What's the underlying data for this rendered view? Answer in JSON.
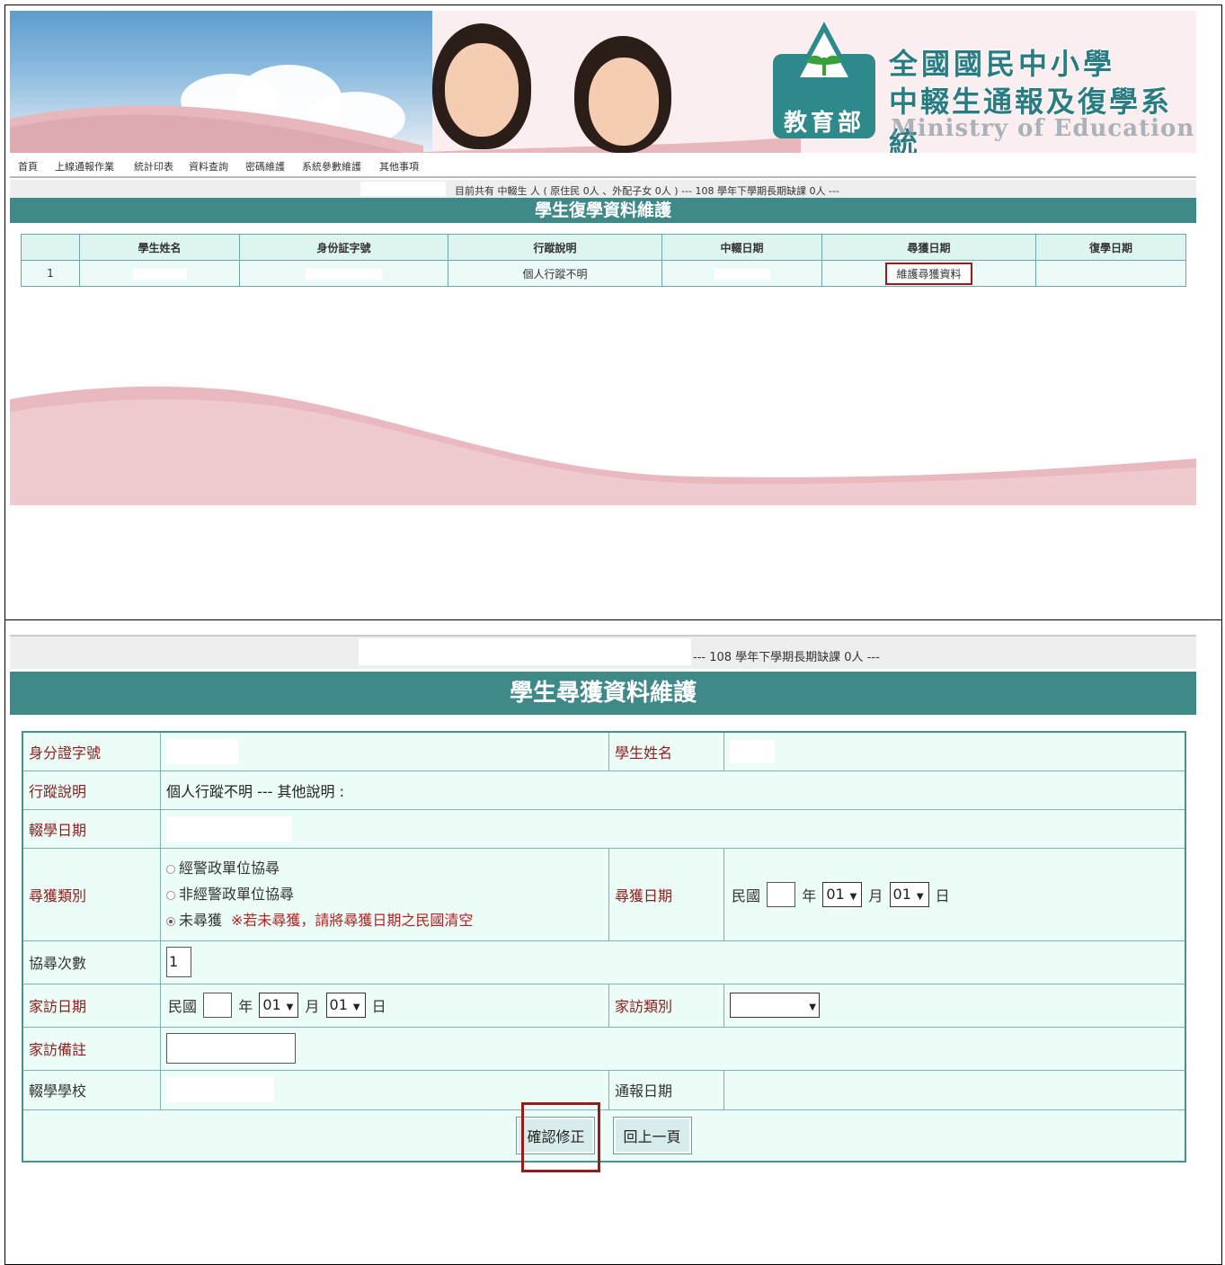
{
  "banner": {
    "ministry_label": "教育部",
    "system_title_line1": "全國國民中小學",
    "system_title_line2": "中輟生通報及復學系統",
    "system_title_en": "Ministry of Education"
  },
  "nav": {
    "items": [
      "首頁",
      "上線通報作業",
      "統計印表",
      "資料查詢",
      "密碼維護",
      "系統參數維護",
      "其他事項"
    ]
  },
  "status_top": "目前共有 中輟生  人 ( 原住民 0人 、外配子女 0人 ) --- 108 學年下學期長期缺課 0人 ---",
  "top_section_title": "學生復學資料維護",
  "top_table": {
    "headers": [
      "",
      "學生姓名",
      "身份証字號",
      "行蹤說明",
      "中輟日期",
      "尋獲日期",
      "復學日期"
    ],
    "row": {
      "index": "1",
      "description": "個人行蹤不明",
      "maintain_link": "維護尋獲資料"
    }
  },
  "status_bottom": "--- 108 學年下學期長期缺課 0人 ---",
  "bottom_section_title": "學生尋獲資料維護",
  "form": {
    "id_label": "身分證字號",
    "name_label": "學生姓名",
    "whereabouts_label": "行蹤說明",
    "whereabouts_value": "個人行蹤不明 --- 其他說明 :",
    "dropout_date_label": "輟學日期",
    "found_type_label": "尋獲類別",
    "found_type_options": [
      "經警政單位協尋",
      "非經警政單位協尋",
      "未尋獲"
    ],
    "found_type_selected": "未尋獲",
    "found_type_note": "※若未尋獲，請將尋獲日期之民國清空",
    "found_date_label": "尋獲日期",
    "era_label": "民國",
    "year_unit": "年",
    "month_unit": "月",
    "day_unit": "日",
    "month_value": "01",
    "day_value": "01",
    "search_count_label": "協尋次數",
    "search_count_value": "1",
    "home_visit_date_label": "家訪日期",
    "home_visit_type_label": "家訪類別",
    "home_visit_note_label": "家訪備註",
    "dropout_school_label": "輟學學校",
    "report_date_label": "通報日期",
    "confirm_button": "確認修正",
    "back_button": "回上一頁"
  },
  "colors": {
    "teal_header": "#3f8a88",
    "light_cell": "#ecfcf7",
    "label_red": "#8b1d1d",
    "highlight_red": "#9a1a1a",
    "banner_pink": "#e8b7bc"
  }
}
